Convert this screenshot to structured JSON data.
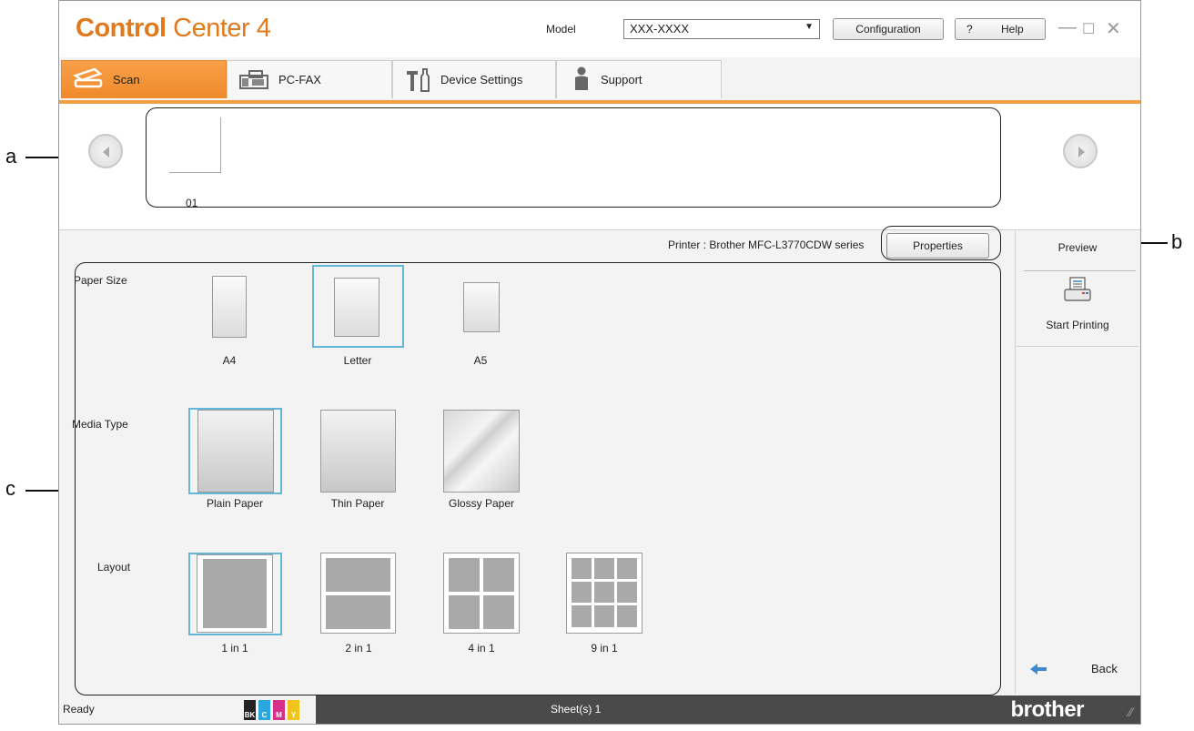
{
  "app": {
    "title_bold": "Control",
    "title_light": "Center 4"
  },
  "header": {
    "model_label": "Model",
    "model_value": "XXX-XXXX",
    "configuration_label": "Configuration",
    "help_q": "?",
    "help_label": "Help"
  },
  "tabs": [
    {
      "label": "Scan",
      "active": true,
      "icon": "scanner-icon"
    },
    {
      "label": "PC-FAX",
      "active": false,
      "icon": "fax-icon"
    },
    {
      "label": "Device Settings",
      "active": false,
      "icon": "tools-icon"
    },
    {
      "label": "Support",
      "active": false,
      "icon": "person-icon"
    }
  ],
  "strip": {
    "thumb_label": "01"
  },
  "print": {
    "printer_text": "Printer : Brother MFC-L3770CDW series",
    "properties_label": "Properties",
    "paper_size_label": "Paper Size",
    "media_type_label": "Media Type",
    "layout_label": "Layout",
    "paper_sizes": [
      "A4",
      "Letter",
      "A5"
    ],
    "paper_size_selected": "Letter",
    "media_types": [
      "Plain Paper",
      "Thin Paper",
      "Glossy Paper"
    ],
    "media_type_selected": "Plain Paper",
    "layouts": [
      "1 in 1",
      "2 in 1",
      "4 in 1",
      "9 in 1"
    ],
    "layout_selected": "1 in 1"
  },
  "right_panel": {
    "preview_label": "Preview",
    "start_printing_label": "Start Printing",
    "back_label": "Back"
  },
  "status": {
    "ready": "Ready",
    "sheets": "Sheet(s) 1",
    "brand": "brother",
    "inks": [
      "BK",
      "C",
      "M",
      "Y"
    ]
  },
  "annotations": {
    "a": "a",
    "b": "b",
    "c": "c"
  },
  "colors": {
    "accent": "#f0962e",
    "selection": "#62b6d8",
    "statusbar": "#4a4a4a"
  }
}
